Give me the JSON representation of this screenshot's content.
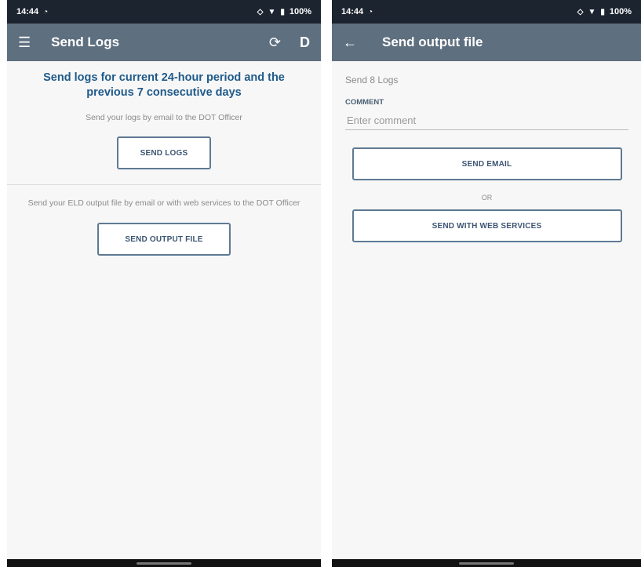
{
  "left": {
    "status": {
      "time": "14:44",
      "battery": "100%"
    },
    "appbar": {
      "title": "Send Logs",
      "profile_letter": "D"
    },
    "heading": "Send logs for current 24-hour period and the previous 7 consecutive days",
    "send_logs_text": "Send your logs by email to the DOT Officer",
    "send_logs_button": "SEND LOGS",
    "send_output_text": "Send your ELD output file by email or with web services to the DOT Officer",
    "send_output_button": "SEND OUTPUT FILE"
  },
  "right": {
    "status": {
      "time": "14:44",
      "battery": "100%"
    },
    "appbar": {
      "title": "Send output file"
    },
    "logs_count": "Send 8 Logs",
    "comment_label": "COMMENT",
    "comment_placeholder": "Enter comment",
    "send_email_button": "SEND EMAIL",
    "or_text": "OR",
    "send_web_button": "SEND WITH WEB SERVICES"
  },
  "colors": {
    "status_bar": "#1c2430",
    "app_bar": "#5e6f7f",
    "heading": "#1f5a8a",
    "button_border": "#5e7a94"
  },
  "icons": {
    "menu": "menu-icon",
    "sync": "sync-icon",
    "back": "back-arrow-icon",
    "wifi": "wifi-icon",
    "battery": "battery-icon",
    "signal": "signal-icon"
  }
}
